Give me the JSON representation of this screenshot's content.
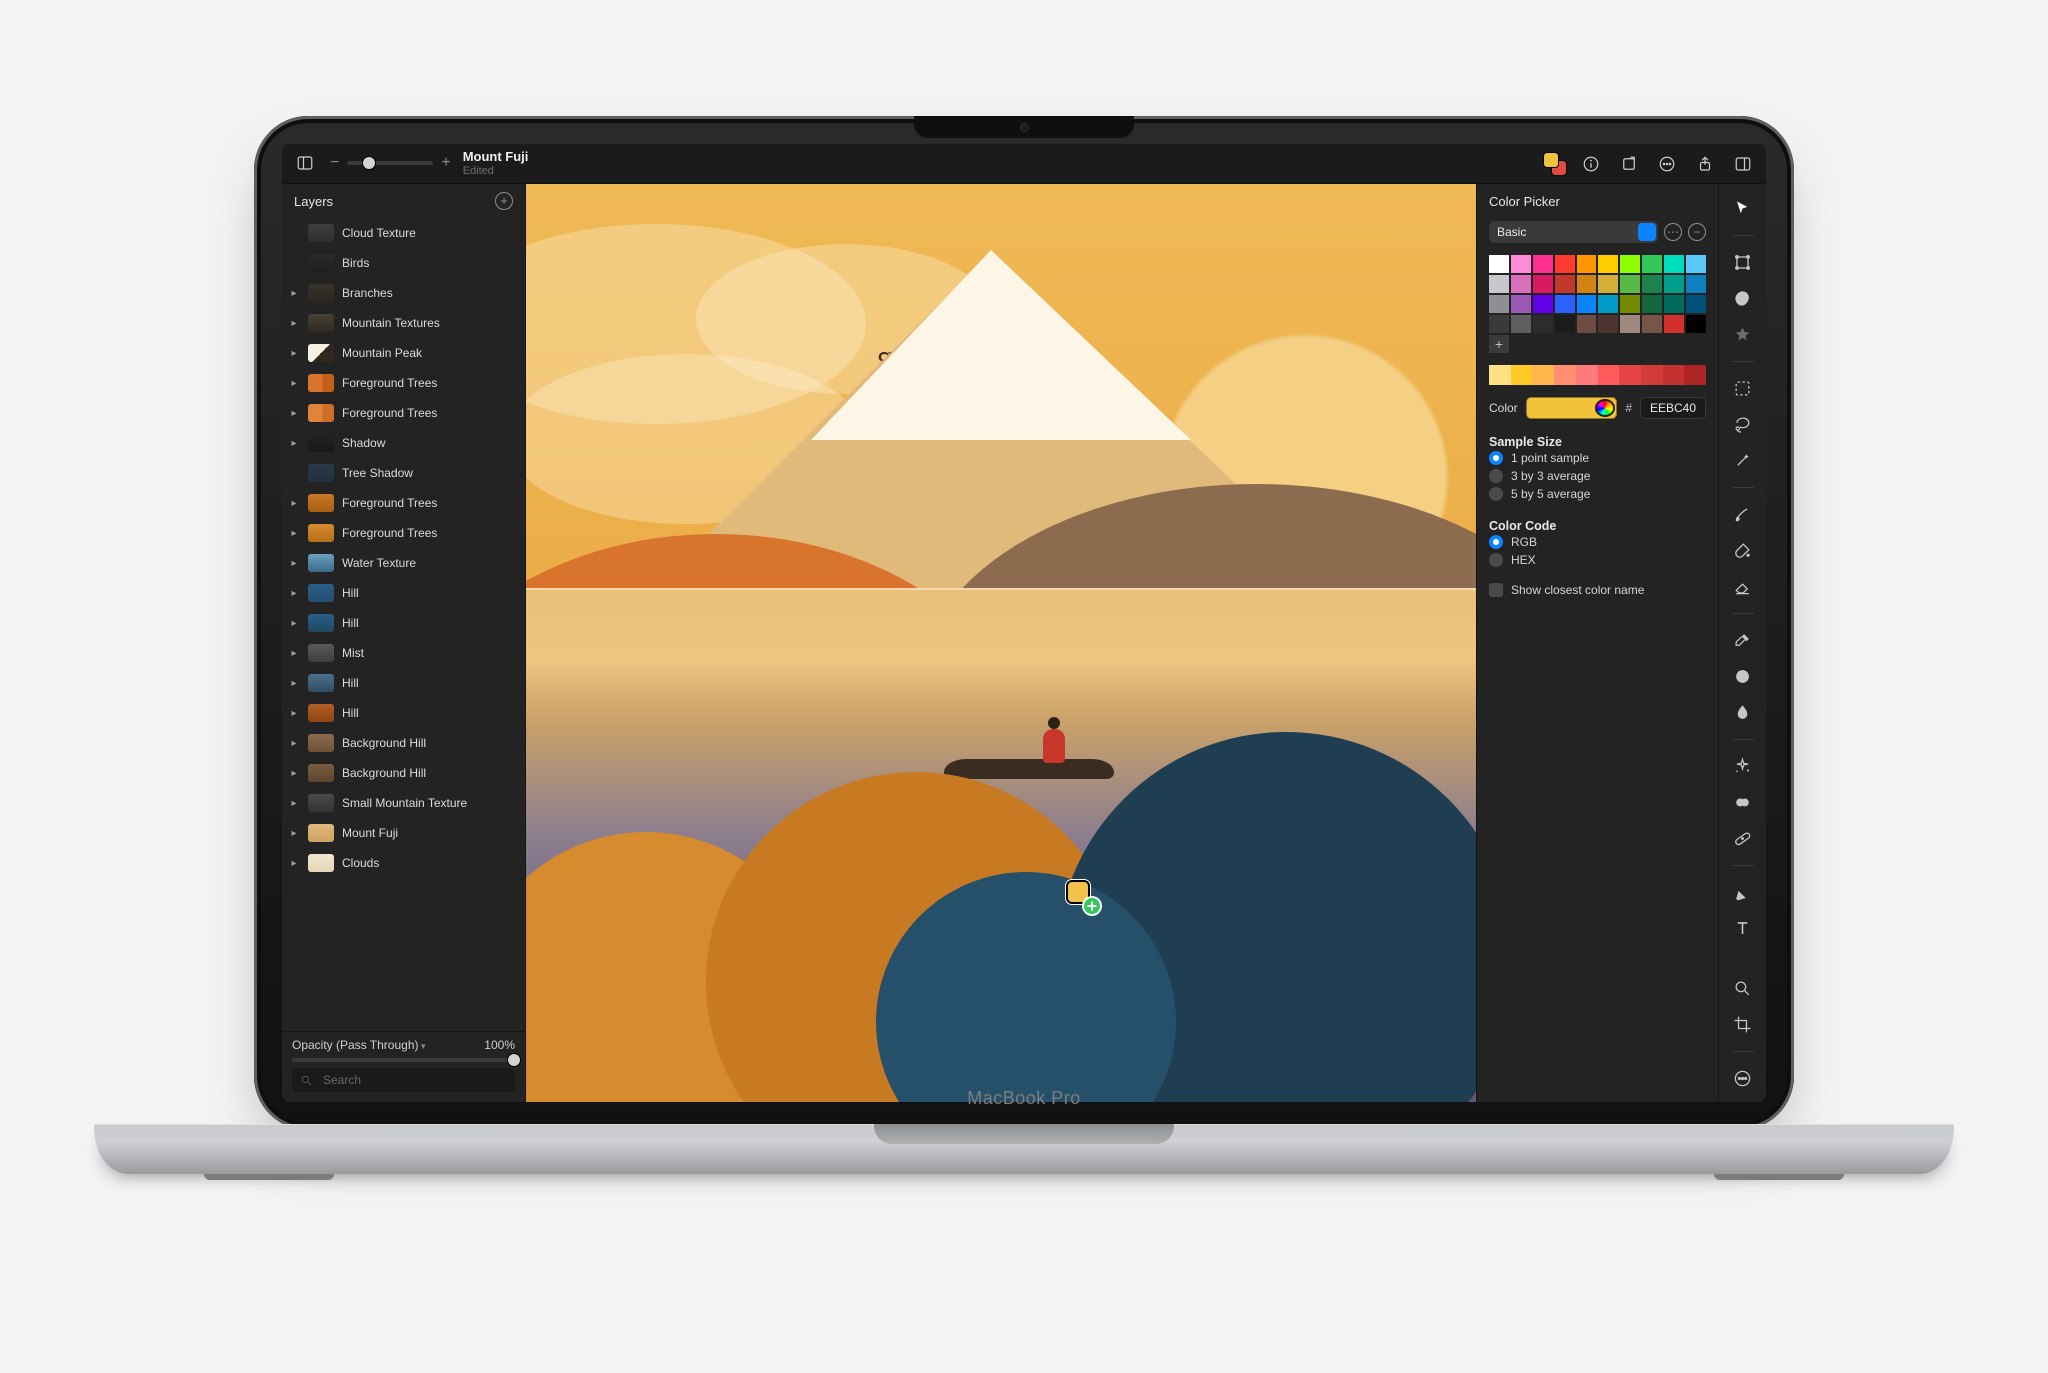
{
  "device_label": "MacBook Pro",
  "title": {
    "name": "Mount Fuji",
    "status": "Edited"
  },
  "toolbar": {
    "fg_color": "#F3C23B",
    "bg_color": "#E24B3F"
  },
  "layers": {
    "title": "Layers",
    "opacity_label": "Opacity (Pass Through)",
    "opacity_value": "100%",
    "search_placeholder": "Search",
    "items": [
      {
        "name": "Cloud Texture",
        "group": false,
        "thumb": "linear-gradient(#3f3f3f,#2f2f2f)"
      },
      {
        "name": "Birds",
        "group": false,
        "thumb": "linear-gradient(#2a2a2a,#202020)"
      },
      {
        "name": "Branches",
        "group": true,
        "thumb": "linear-gradient(#3a332b,#2b2620)"
      },
      {
        "name": "Mountain Textures",
        "group": true,
        "thumb": "linear-gradient(#4a4035,#2f2a22)"
      },
      {
        "name": "Mountain Peak",
        "group": true,
        "thumb": "linear-gradient(135deg,#f4efe2 0 50%,#30271d 50%)"
      },
      {
        "name": "Foreground Trees",
        "group": true,
        "thumb": "linear-gradient(90deg,#d9742c 0 55%,#c45f18 55%)"
      },
      {
        "name": "Foreground Trees",
        "group": true,
        "thumb": "linear-gradient(90deg,#e08439 0 55%,#cc6e26 55%)"
      },
      {
        "name": "Shadow",
        "group": true,
        "thumb": "linear-gradient(#232323,#181818)"
      },
      {
        "name": "Tree Shadow",
        "group": false,
        "thumb": "linear-gradient(#2b3a4a,#22303e)"
      },
      {
        "name": "Foreground Trees",
        "group": true,
        "thumb": "linear-gradient(#c77a26,#a85e15)"
      },
      {
        "name": "Foreground Trees",
        "group": true,
        "thumb": "linear-gradient(#d68b2e,#b66f1a)"
      },
      {
        "name": "Water Texture",
        "group": true,
        "thumb": "linear-gradient(#6aa0c0,#3c6a86)"
      },
      {
        "name": "Hill",
        "group": true,
        "thumb": "linear-gradient(#2b5f86,#244f70)"
      },
      {
        "name": "Hill",
        "group": true,
        "thumb": "linear-gradient(#2b5f86,#1f4863)"
      },
      {
        "name": "Mist",
        "group": true,
        "thumb": "linear-gradient(#5a5a5a,#3e3e3e)"
      },
      {
        "name": "Hill",
        "group": true,
        "thumb": "linear-gradient(#4a6f8c,#2f4e65)"
      },
      {
        "name": "Hill",
        "group": true,
        "thumb": "linear-gradient(#b25e24,#8d4515)"
      },
      {
        "name": "Background Hill",
        "group": true,
        "thumb": "linear-gradient(#8c6b4e,#6e5238)"
      },
      {
        "name": "Background Hill",
        "group": true,
        "thumb": "linear-gradient(#7a5c40,#5d462f)"
      },
      {
        "name": "Small Mountain Texture",
        "group": true,
        "thumb": "linear-gradient(#4a4a4a,#333333)"
      },
      {
        "name": "Mount Fuji",
        "group": true,
        "thumb": "linear-gradient(#e0ba7b,#caa264)"
      },
      {
        "name": "Clouds",
        "group": true,
        "thumb": "linear-gradient(#efe6cf,#e4d6b4)"
      }
    ]
  },
  "inspector": {
    "title": "Color Picker",
    "palette_mode": "Basic",
    "swatches_main": [
      "#ffffff",
      "#ff8ad8",
      "#ff2f92",
      "#ff3b30",
      "#ff9500",
      "#ffcc00",
      "#8cff00",
      "#34c759",
      "#00dcc0",
      "#5ac8fa",
      "#c7c7cc",
      "#d96fba",
      "#d81b60",
      "#c0392b",
      "#d38312",
      "#d4af37",
      "#58b947",
      "#1e824c",
      "#009f8b",
      "#0f7fbf",
      "#8e8e93",
      "#9b59b6",
      "#6200ea",
      "#2962ff",
      "#0a84ff",
      "#009bc4",
      "#768c00",
      "#14663b",
      "#006c5b",
      "#00527a",
      "#3a3a3c",
      "#5e5e60",
      "#2c2c2e",
      "#1c1c1e",
      "#6d4c41",
      "#4e342e",
      "#a1887f",
      "#795548",
      "#d32f2f",
      "#000000"
    ],
    "swatches_recent": [
      "#ffe082",
      "#ffca28",
      "#ffb74d",
      "#ff8f70",
      "#ff7a7a",
      "#ff5a5a",
      "#e64545",
      "#d33a3a",
      "#c33131",
      "#ad2525"
    ],
    "color_label": "Color",
    "current_color": "#F3C23B",
    "hex_value": "EEBC40",
    "sample_title": "Sample Size",
    "sample_options": [
      "1 point sample",
      "3 by 3 average",
      "5 by 5 average"
    ],
    "sample_selected": 0,
    "code_title": "Color Code",
    "code_options": [
      "RGB",
      "HEX"
    ],
    "code_selected": 0,
    "show_name_label": "Show closest color name",
    "show_name_checked": false
  },
  "tools": [
    {
      "name": "move-tool",
      "icon": "cursor",
      "sep": false,
      "active": true
    },
    {
      "name": "",
      "icon": "",
      "sep": true
    },
    {
      "name": "transform-tool",
      "icon": "transform",
      "sep": false
    },
    {
      "name": "shape-tool",
      "icon": "blob",
      "sep": false,
      "filled": true
    },
    {
      "name": "favorites",
      "icon": "star",
      "sep": false,
      "filled": true,
      "dim": true
    },
    {
      "name": "",
      "icon": "",
      "sep": true
    },
    {
      "name": "marquee-tool",
      "icon": "marquee",
      "sep": false
    },
    {
      "name": "lasso-tool",
      "icon": "lasso",
      "sep": false
    },
    {
      "name": "magic-wand-tool",
      "icon": "wand",
      "sep": false
    },
    {
      "name": "",
      "icon": "",
      "sep": true
    },
    {
      "name": "brush-tool",
      "icon": "brush",
      "sep": false
    },
    {
      "name": "fill-tool",
      "icon": "bucket",
      "sep": false
    },
    {
      "name": "eraser-tool",
      "icon": "eraser",
      "sep": false
    },
    {
      "name": "",
      "icon": "",
      "sep": true
    },
    {
      "name": "eyedropper-tool",
      "icon": "dropper",
      "sep": false
    },
    {
      "name": "gradient-tool",
      "icon": "gradient",
      "sep": false,
      "filled": true
    },
    {
      "name": "smudge-tool",
      "icon": "smudge",
      "sep": false,
      "filled": true
    },
    {
      "name": "",
      "icon": "",
      "sep": true
    },
    {
      "name": "sparkle-tool",
      "icon": "sparkle",
      "sep": false
    },
    {
      "name": "clone-tool",
      "icon": "clone",
      "sep": false,
      "filled": true
    },
    {
      "name": "heal-tool",
      "icon": "bandage",
      "sep": false
    },
    {
      "name": "",
      "icon": "",
      "sep": true
    },
    {
      "name": "pen-tool",
      "icon": "pen",
      "sep": false,
      "filled": true
    },
    {
      "name": "text-tool",
      "icon": "text",
      "sep": false
    }
  ],
  "tools_bottom": [
    {
      "name": "zoom-tool",
      "icon": "zoom"
    },
    {
      "name": "crop-tool",
      "icon": "crop"
    },
    {
      "name": "",
      "icon": "",
      "sep": true
    },
    {
      "name": "more-tools",
      "icon": "more"
    }
  ]
}
